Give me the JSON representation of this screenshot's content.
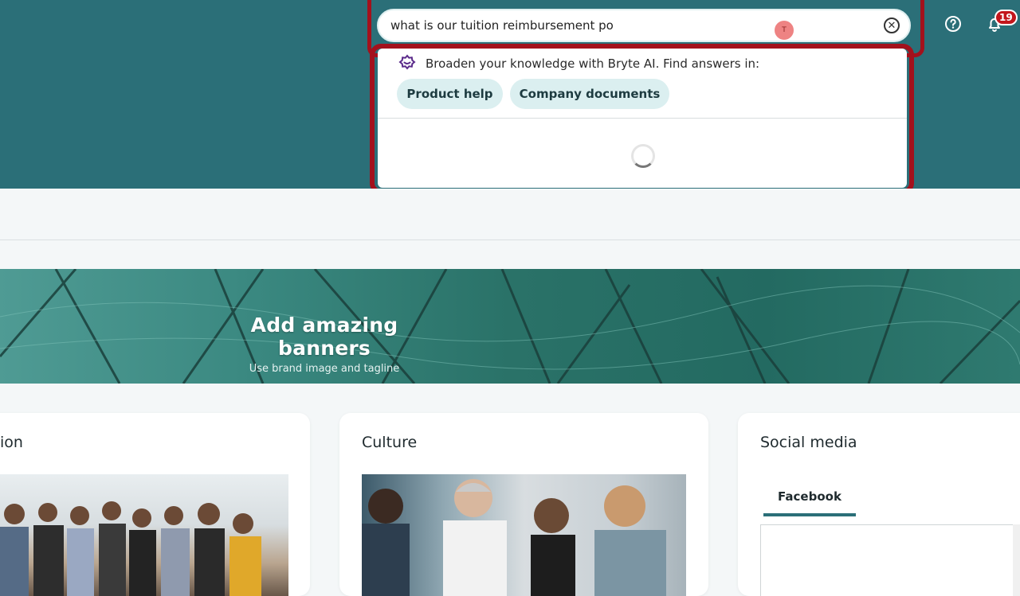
{
  "header": {
    "search": {
      "value": "what is our tuition reimbursement po",
      "placeholder": ""
    },
    "cursor_marker": "T",
    "notifications_count": "19"
  },
  "dropdown": {
    "ai_prompt": "Broaden your knowledge with Bryte AI. Find answers in:",
    "chips": [
      "Product help",
      "Company documents"
    ],
    "loading": true
  },
  "banner": {
    "title": "Add amazing banners",
    "subtitle": "Use brand image and tagline"
  },
  "cards": {
    "left_title": "ion",
    "culture_title": "Culture",
    "social_title": "Social media",
    "social_tab": "Facebook"
  },
  "colors": {
    "brand_teal": "#2b6f78",
    "highlight_red": "#a3111c",
    "chip_bg": "#dbeff0",
    "badge_red": "#c3161c"
  },
  "icons": [
    "clear-icon",
    "help-icon",
    "bell-icon",
    "bryte-ai-icon",
    "loading-spinner"
  ]
}
